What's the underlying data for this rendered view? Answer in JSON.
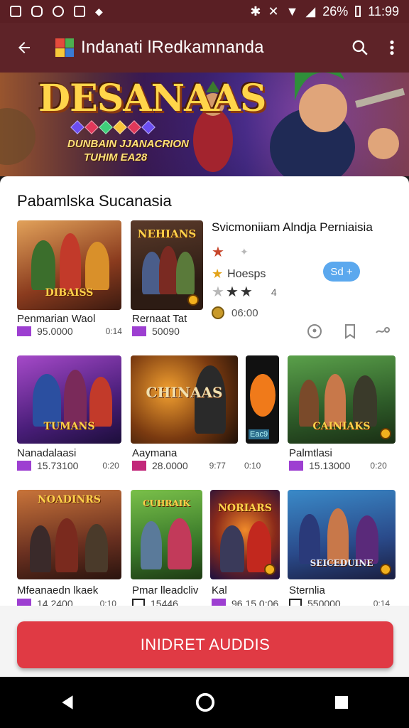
{
  "status": {
    "battery": "26%",
    "time": "11:99"
  },
  "appbar": {
    "title": "Indanati lRedkamnanda"
  },
  "banner": {
    "logo_text": "DESANAAS",
    "sub1": "DUNBAIN JJANACRION",
    "sub2": "TUHIM EA28"
  },
  "section": {
    "title": "Pabamlska Sucanasia"
  },
  "featured": {
    "title": "Svicmoniiam Alndja Perniaisia",
    "rating_text": "Hoesps",
    "rating_suffix": "4",
    "price_label": "06:00",
    "pill_label": "Sd +"
  },
  "tiles": [
    {
      "art": "DIBAISS",
      "caption": "Penmarian Waol",
      "meta": "95.0000",
      "right": "0:14",
      "mark": "purple"
    },
    {
      "art": "NEHIANS",
      "caption": "Rernaat Tat",
      "meta": "50090",
      "right": "",
      "mark": "purple"
    },
    {
      "art": "TUMANS",
      "caption": "Nanadalaasi",
      "meta": "15.73100",
      "right": "0:20",
      "mark": "purple"
    },
    {
      "art": "CHINAAS",
      "caption": "Aaymana",
      "meta": "28.0000",
      "right": "9:77",
      "mark": "pink",
      "right2": "0:10"
    },
    {
      "art": "",
      "caption": "",
      "meta": "",
      "right": "",
      "mark": "none",
      "art_small": "Eac9"
    },
    {
      "art": "CAINIAKS",
      "caption": "Palmtlasi",
      "meta": "15.13000",
      "right": "0:20",
      "mark": "purple"
    },
    {
      "art": "NOADINRS",
      "caption": "Mfeanaedn lkaek",
      "meta": "14.2400",
      "right": "0:10",
      "mark": "purple"
    },
    {
      "art": "CUHRAIK",
      "caption": "Pmar lleadcliv",
      "meta": "15446",
      "right": "",
      "mark": "out"
    },
    {
      "art": "NORIARS",
      "caption": "Kal",
      "meta": "96.15 0:06",
      "right": "",
      "mark": "purple"
    },
    {
      "art": "SEICEDUINE",
      "caption": "Sternlia",
      "meta": "550000",
      "right": "0:14",
      "mark": "out"
    }
  ],
  "cta": {
    "label": "INIDRET AUDDIS"
  },
  "colors": {
    "appbar": "#5e2328",
    "accent": "#e03a44",
    "pill": "#5ba8ee",
    "meta_purple": "#9d3fd1"
  }
}
